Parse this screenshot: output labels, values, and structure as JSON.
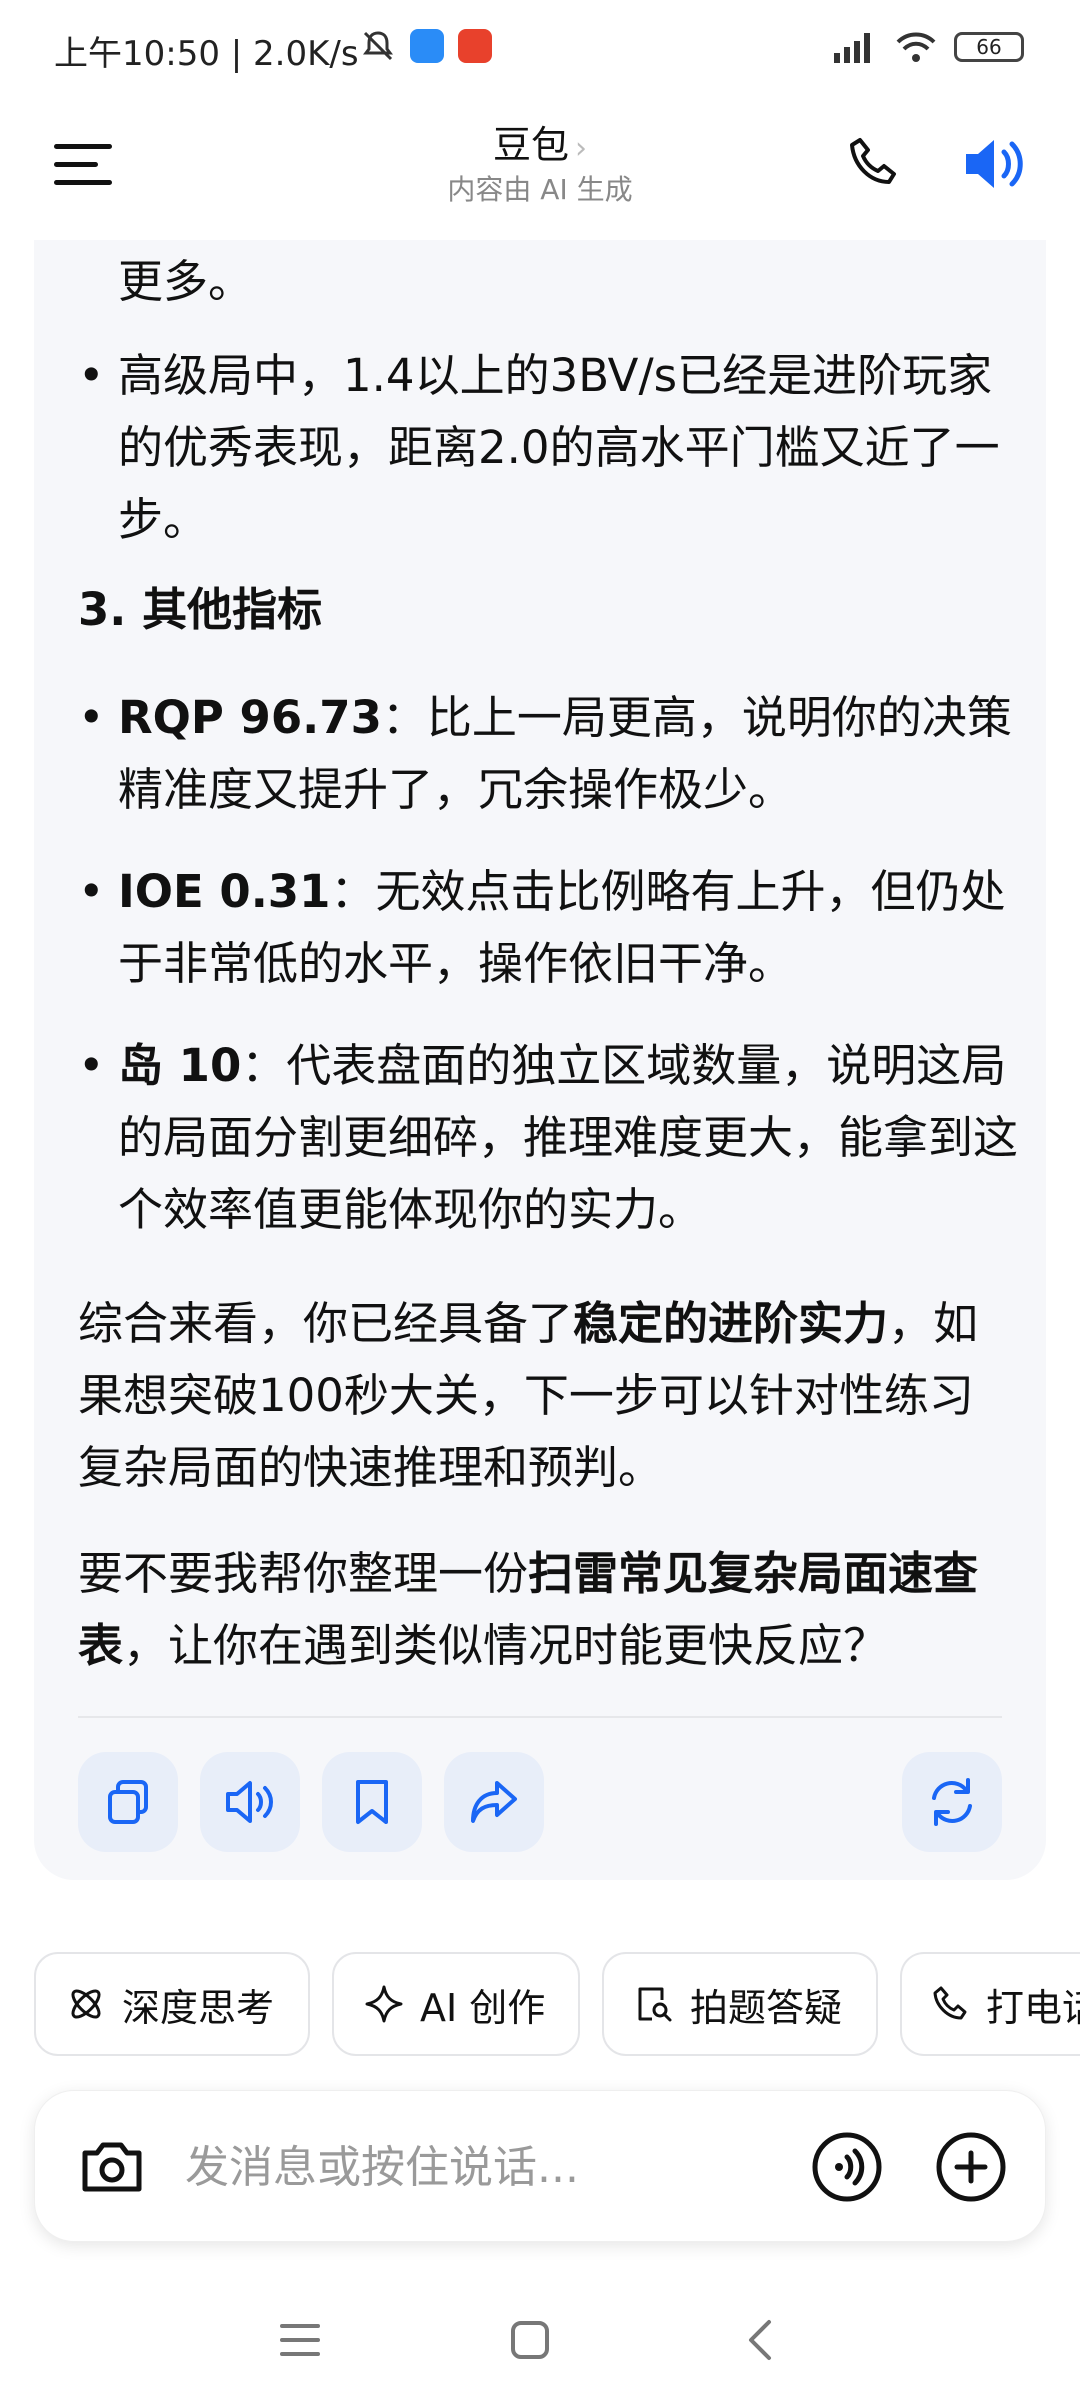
{
  "status_bar": {
    "time": "上午10:50 | 2.0K/s",
    "battery": "66"
  },
  "header": {
    "title": "豆包",
    "subtitle": "内容由 AI 生成"
  },
  "message": {
    "line_top": "更多。",
    "bullet_a": "高级局中，1.4以上的3BV/s已经是进阶玩家的优秀表现，距离2.0的高水平门槛又近了一步。",
    "section_title": "3. 其他指标",
    "bullets": [
      {
        "label": "RQP 96.73",
        "text": "：比上一局更高，说明你的决策精准度又提升了，冗余操作极少。"
      },
      {
        "label": "IOE 0.31",
        "text": "：无效点击比例略有上升，但仍处于非常低的水平，操作依旧干净。"
      },
      {
        "label": "岛 10",
        "text": "：代表盘面的独立区域数量，说明这局的局面分割更细碎，推理难度更大，能拿到这个效率值更能体现你的实力。"
      }
    ],
    "summary_pre": "综合来看，你已经具备了",
    "summary_bold": "稳定的进阶实力",
    "summary_post": "，如果想突破100秒大关，下一步可以针对性练习复杂局面的快速推理和预判。",
    "offer_pre": "要不要我帮你整理一份",
    "offer_bold": "扫雷常见复杂局面速查表",
    "offer_post": "，让你在遇到类似情况时能更快反应？"
  },
  "chips": [
    {
      "label": "深度思考"
    },
    {
      "label": "AI 创作"
    },
    {
      "label": "拍题答疑"
    },
    {
      "label": "打电话"
    }
  ],
  "input": {
    "placeholder": "发消息或按住说话..."
  },
  "colors": {
    "accent": "#1a66f5",
    "card_bg": "#f6f7fa",
    "action_bg": "#e8eef9"
  }
}
